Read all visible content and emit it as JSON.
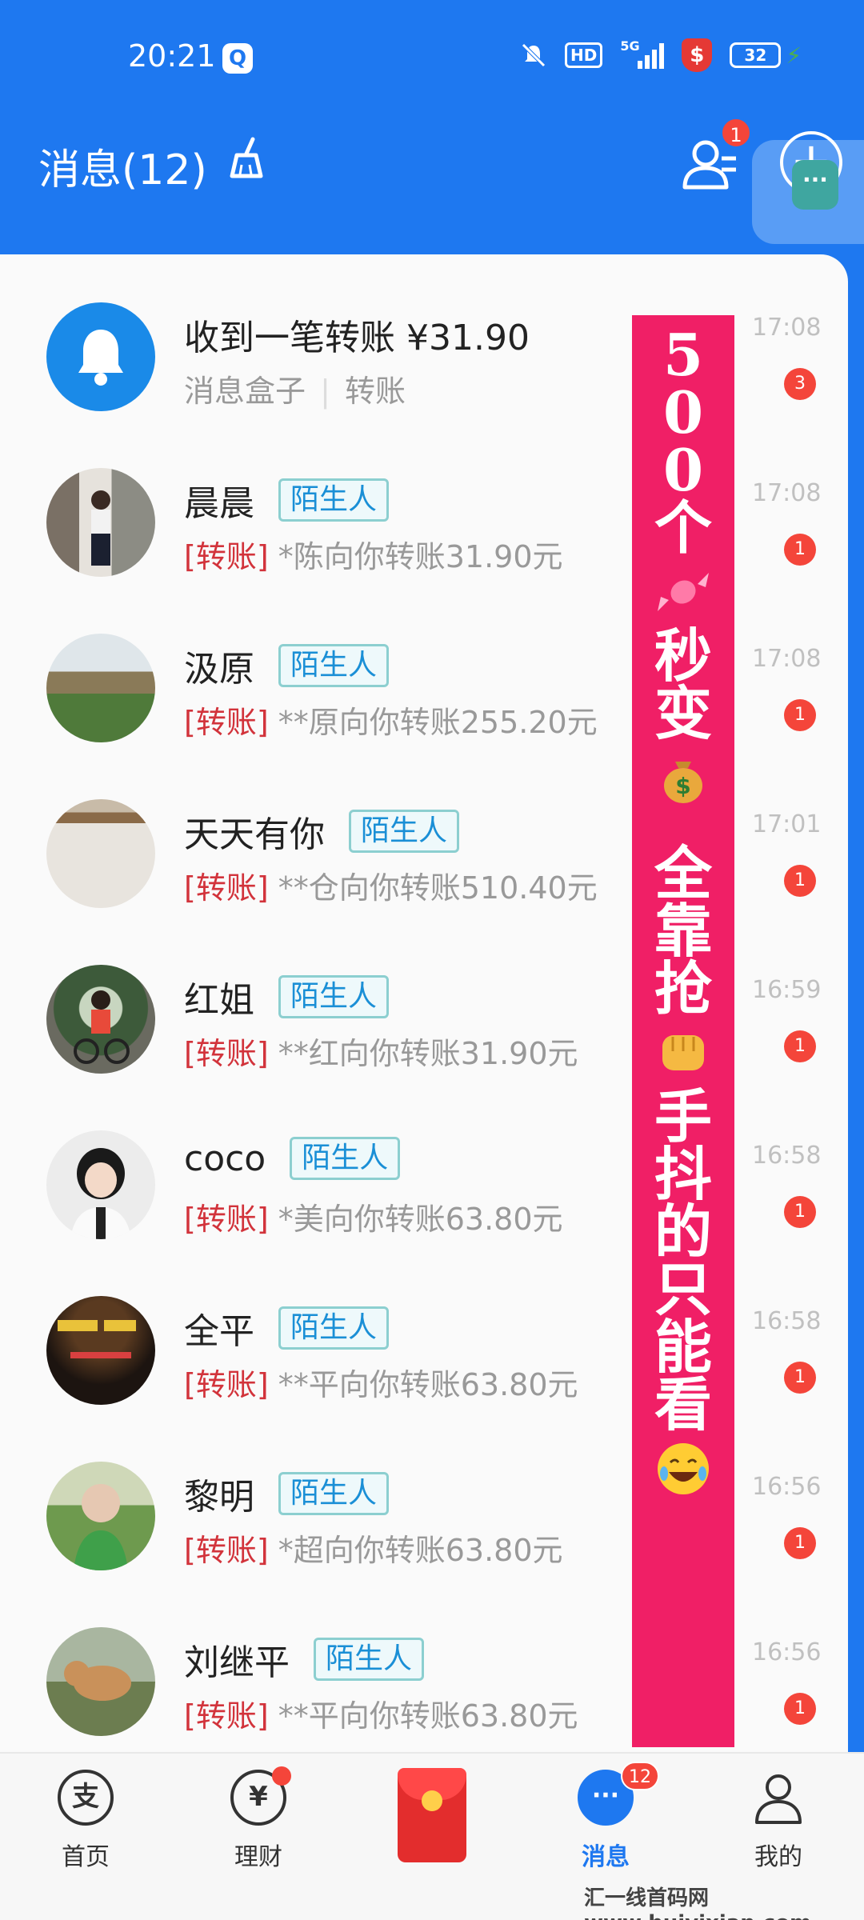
{
  "status_bar": {
    "time": "20:21",
    "network": "5G",
    "hd": "HD",
    "battery": "32"
  },
  "header": {
    "title": "消息(12)",
    "contacts_badge": "1"
  },
  "messages": [
    {
      "name": "收到一笔转账 ¥31.90",
      "source": "消息盒子",
      "divider": "|",
      "category": "转账",
      "time": "17:08",
      "badge": "3"
    },
    {
      "name": "晨晨",
      "tag": "陌生人",
      "prefix": "[转账]",
      "text": "*陈向你转账31.90元",
      "time": "17:08",
      "badge": "1"
    },
    {
      "name": "汲原",
      "tag": "陌生人",
      "prefix": "[转账]",
      "text": "**原向你转账255.20元",
      "time": "17:08",
      "badge": "1"
    },
    {
      "name": "天天有你",
      "tag": "陌生人",
      "prefix": "[转账]",
      "text": "**仓向你转账510.40元",
      "time": "17:01",
      "badge": "1"
    },
    {
      "name": "红姐",
      "tag": "陌生人",
      "prefix": "[转账]",
      "text": "**红向你转账31.90元",
      "time": "16:59",
      "badge": "1"
    },
    {
      "name": "coco",
      "tag": "陌生人",
      "prefix": "[转账]",
      "text": "*美向你转账63.80元",
      "time": "16:58",
      "badge": "1"
    },
    {
      "name": "全平",
      "tag": "陌生人",
      "prefix": "[转账]",
      "text": "**平向你转账63.80元",
      "time": "16:58",
      "badge": "1"
    },
    {
      "name": "黎明",
      "tag": "陌生人",
      "prefix": "[转账]",
      "text": "*超向你转账63.80元",
      "time": "16:56",
      "badge": "1"
    },
    {
      "name": "刘继平",
      "tag": "陌生人",
      "prefix": "[转账]",
      "text": "**平向你转账63.80元",
      "time": "16:56",
      "badge": "1"
    }
  ],
  "sticker": {
    "chars": [
      "5",
      "0",
      "0",
      "个",
      "秒",
      "变",
      "全",
      "靠",
      "抢",
      "手",
      "抖",
      "的",
      "只",
      "能",
      "看"
    ],
    "icons": [
      "candy-icon",
      "money-bag-icon",
      "fist-icon",
      "laughing-face-icon"
    ]
  },
  "bottom_nav": [
    {
      "label": "首页",
      "icon": "alipay-icon"
    },
    {
      "label": "理财",
      "icon": "yuan-icon"
    },
    {
      "label": "",
      "icon": "red-packet-icon"
    },
    {
      "label": "消息",
      "icon": "chat-bubble-icon",
      "badge": "12"
    },
    {
      "label": "我的",
      "icon": "person-icon"
    }
  ],
  "watermark": "汇一线首码网  www.huiyixian.com",
  "colors": {
    "brand_blue": "#1e78f0",
    "badge_red": "#f4453a",
    "transfer_red": "#d2333b",
    "sticker_pink": "#f01f66",
    "stranger_tag": "#1a8fd6"
  }
}
